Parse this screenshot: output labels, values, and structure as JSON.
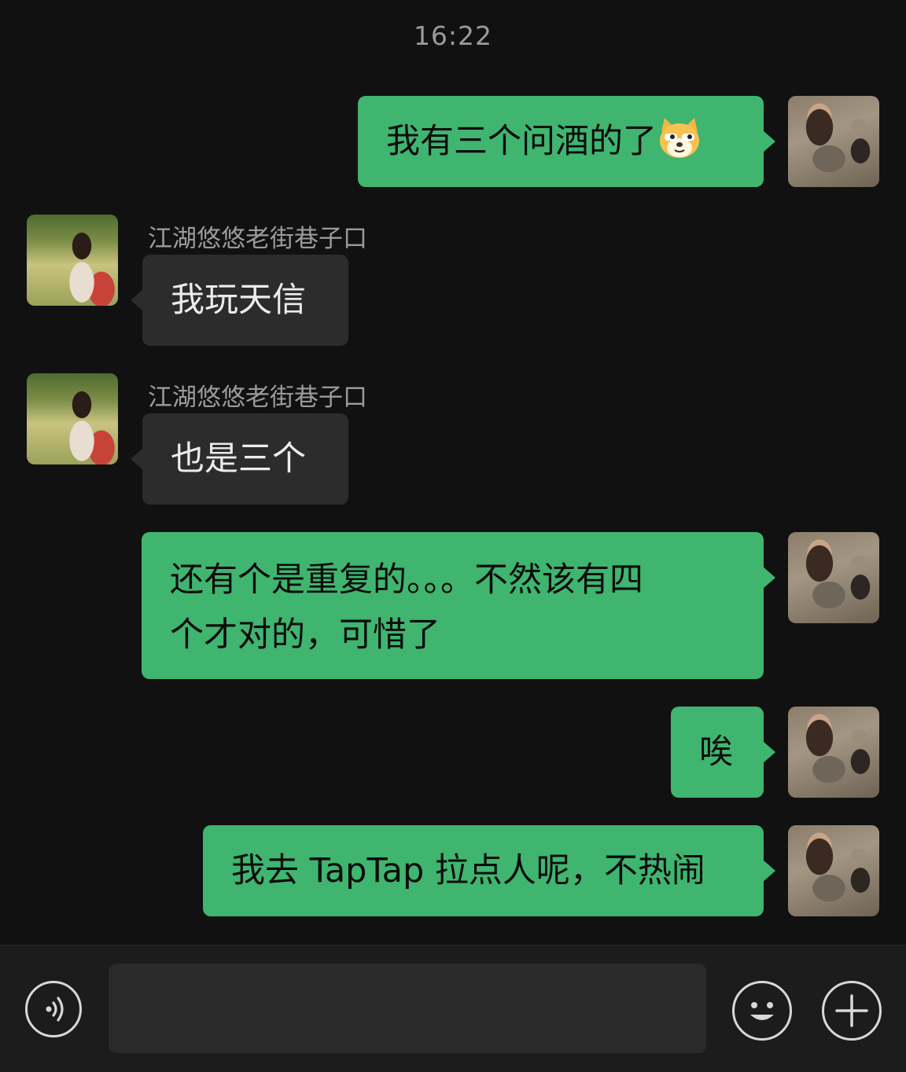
{
  "status": {
    "time": "16:22"
  },
  "contact": {
    "name": "江湖悠悠老街巷子口"
  },
  "messages": [
    {
      "side": "right",
      "text": "我有三个问酒的了",
      "emoji": "doge-emoji"
    },
    {
      "side": "left",
      "sender": "江湖悠悠老街巷子口",
      "text": "我玩天信"
    },
    {
      "side": "left",
      "sender": "江湖悠悠老街巷子口",
      "text": "也是三个"
    },
    {
      "side": "right",
      "line1": "还有个是重复的。。。不然该有四",
      "line2": "个才对的，可惜了"
    },
    {
      "side": "right",
      "text": "唉"
    },
    {
      "side": "right",
      "text": "我去 TapTap 拉点人呢，不热闹"
    }
  ],
  "input": {
    "value": "",
    "placeholder": ""
  },
  "icons": {
    "voice": "voice-icon",
    "emoji": "smile-icon",
    "more": "plus-icon"
  },
  "colors": {
    "background": "#111111",
    "self_bubble": "#3fb56f",
    "other_bubble": "#2c2c2c",
    "input_bar": "#1c1c1c"
  }
}
